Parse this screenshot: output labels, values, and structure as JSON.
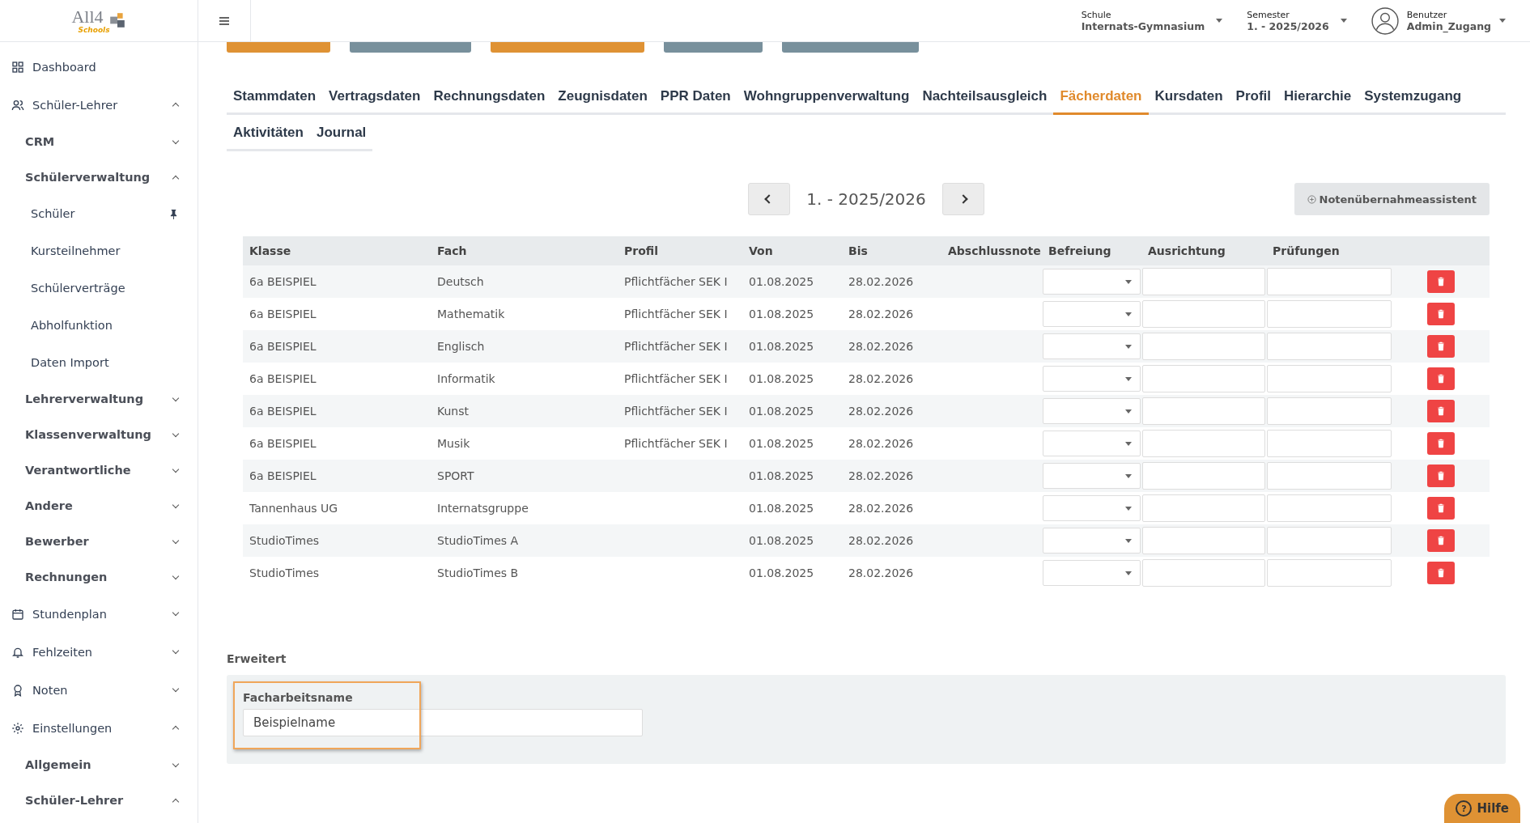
{
  "logo": {
    "main": "All4",
    "sub": "Schools"
  },
  "topbar": {
    "selectors": [
      {
        "label": "Schule",
        "value": "Internats-Gymnasium"
      },
      {
        "label": "Semester",
        "value": "1. - 2025/2026"
      }
    ],
    "user": {
      "label": "Benutzer",
      "value": "Admin_Zugang"
    }
  },
  "sidebar": {
    "items": [
      {
        "label": "Dashboard",
        "kind": "link"
      },
      {
        "label": "Schüler-Lehrer",
        "kind": "group",
        "expanded": true,
        "children": [
          {
            "label": "CRM",
            "expanded": false
          },
          {
            "label": "Schülerverwaltung",
            "expanded": true,
            "children": [
              {
                "label": "Schüler",
                "pinned": true
              },
              {
                "label": "Kursteilnehmer",
                "pinned": false
              },
              {
                "label": "Schülerverträge",
                "pinned": false
              },
              {
                "label": "Abholfunktion",
                "pinned": false
              },
              {
                "label": "Daten Import",
                "pinned": false
              }
            ]
          },
          {
            "label": "Lehrerverwaltung",
            "expanded": false
          },
          {
            "label": "Klassenverwaltung",
            "expanded": false
          },
          {
            "label": "Verantwortliche",
            "expanded": false
          },
          {
            "label": "Andere",
            "expanded": false
          },
          {
            "label": "Bewerber",
            "expanded": false
          },
          {
            "label": "Rechnungen",
            "expanded": false
          }
        ]
      },
      {
        "label": "Stundenplan",
        "kind": "group",
        "expanded": false
      },
      {
        "label": "Fehlzeiten",
        "kind": "group",
        "expanded": false
      },
      {
        "label": "Noten",
        "kind": "group",
        "expanded": false
      },
      {
        "label": "Einstellungen",
        "kind": "group",
        "expanded": true,
        "children": [
          {
            "label": "Allgemein",
            "expanded": false
          },
          {
            "label": "Schüler-Lehrer",
            "expanded": true
          }
        ]
      }
    ]
  },
  "action_buttons": [
    {
      "color": "#df9234"
    },
    {
      "color": "#78909c"
    },
    {
      "color": "#df9234"
    },
    {
      "color": "#78909c"
    },
    {
      "color": "#78909c"
    }
  ],
  "tabs": [
    [
      {
        "label": "Stammdaten",
        "selected": false
      },
      {
        "label": "Vertragsdaten",
        "selected": false
      },
      {
        "label": "Rechnungsdaten",
        "selected": false
      },
      {
        "label": "Zeugnisdaten",
        "selected": false
      },
      {
        "label": "PPR Daten",
        "selected": false
      },
      {
        "label": "Wohngruppenverwaltung",
        "selected": false
      },
      {
        "label": "Nachteilsausgleich",
        "selected": false
      },
      {
        "label": "Fächerdaten",
        "selected": true
      },
      {
        "label": "Kursdaten",
        "selected": false
      },
      {
        "label": "Profil",
        "selected": false
      },
      {
        "label": "Hierarchie",
        "selected": false
      },
      {
        "label": "Systemzugang",
        "selected": false
      }
    ],
    [
      {
        "label": "Aktivitäten",
        "selected": false
      },
      {
        "label": "Journal",
        "selected": false
      }
    ]
  ],
  "semester_nav": {
    "value": "1. - 2025/2026"
  },
  "assistant_button": {
    "label": "Notenübernahmeassistent"
  },
  "table": {
    "columns": [
      "Klasse",
      "Fach",
      "Profil",
      "Von",
      "Bis",
      "Abschlussnote",
      "Befreiung",
      "Ausrichtung",
      "Prüfungen"
    ],
    "rows": [
      {
        "klasse": "6a BEISPIEL",
        "fach": "Deutsch",
        "profil": "Pflichtfächer SEK I",
        "von": "01.08.2025",
        "bis": "28.02.2026"
      },
      {
        "klasse": "6a BEISPIEL",
        "fach": "Mathematik",
        "profil": "Pflichtfächer SEK I",
        "von": "01.08.2025",
        "bis": "28.02.2026"
      },
      {
        "klasse": "6a BEISPIEL",
        "fach": "Englisch",
        "profil": "Pflichtfächer SEK I",
        "von": "01.08.2025",
        "bis": "28.02.2026"
      },
      {
        "klasse": "6a BEISPIEL",
        "fach": "Informatik",
        "profil": "Pflichtfächer SEK I",
        "von": "01.08.2025",
        "bis": "28.02.2026"
      },
      {
        "klasse": "6a BEISPIEL",
        "fach": "Kunst",
        "profil": "Pflichtfächer SEK I",
        "von": "01.08.2025",
        "bis": "28.02.2026"
      },
      {
        "klasse": "6a BEISPIEL",
        "fach": "Musik",
        "profil": "Pflichtfächer SEK I",
        "von": "01.08.2025",
        "bis": "28.02.2026"
      },
      {
        "klasse": "6a BEISPIEL",
        "fach": "SPORT",
        "von": "01.08.2025",
        "bis": "28.02.2026"
      },
      {
        "klasse": "Tannenhaus UG",
        "fach": "Internatsgruppe",
        "von": "01.08.2025",
        "bis": "28.02.2026"
      },
      {
        "klasse": "StudioTimes",
        "fach": "StudioTimes A",
        "von": "01.08.2025",
        "bis": "28.02.2026"
      },
      {
        "klasse": "StudioTimes",
        "fach": "StudioTimes B",
        "von": "01.08.2025",
        "bis": "28.02.2026"
      }
    ]
  },
  "extended": {
    "title": "Erweitert",
    "field": {
      "label": "Facharbeitsname",
      "value": "Beispielname"
    }
  },
  "help_button": {
    "icon": "?",
    "label": "Hilfe"
  }
}
